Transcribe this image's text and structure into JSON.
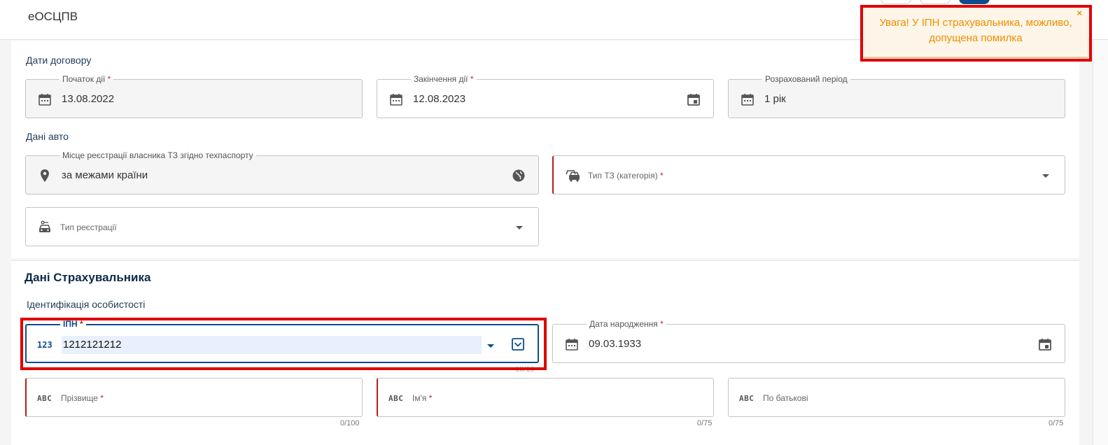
{
  "app": {
    "title": "еОСЦПВ"
  },
  "contract": {
    "section_label": "Дати договору",
    "start": {
      "label": "Початок дії",
      "required": "*",
      "value": "13.08.2022"
    },
    "end": {
      "label": "Закінчення дії",
      "required": "*",
      "value": "12.08.2023"
    },
    "period": {
      "label": "Розрахований період",
      "value": "1 рік"
    }
  },
  "vehicle": {
    "section_label": "Дані авто",
    "registration_place": {
      "label": "Місце реєстрації власника ТЗ згідно техпаспорту",
      "value": "за межами країни"
    },
    "vehicle_type": {
      "placeholder": "Тип ТЗ (категорія)",
      "required": "*"
    },
    "registration_type": {
      "placeholder": "Тип реєстрації"
    }
  },
  "insurer": {
    "title": "Дані Страхувальника",
    "identification_label": "Ідентифікація особистості",
    "ipn": {
      "label": "ІПН",
      "required": "*",
      "value": "1212121212",
      "counter": "10/10"
    },
    "birth_date": {
      "label": "Дата народження",
      "required": "*",
      "value": "09.03.1933"
    },
    "surname": {
      "placeholder": "Прізвище",
      "required": "*",
      "counter": "0/100"
    },
    "name": {
      "placeholder": "Ім'я",
      "required": "*",
      "counter": "0/75"
    },
    "patronymic": {
      "placeholder": "По батькові",
      "counter": "0/75"
    },
    "abc_badge": "ABC",
    "num_badge": "123"
  },
  "toast": {
    "message": "Увага! У ІПН страхувальника, можливо, допущена помилка",
    "close": "×"
  },
  "colors": {
    "accent": "#0d4c8b",
    "error": "#b71c1c",
    "warning": "#f08c00",
    "highlight_box": "#e00000"
  }
}
